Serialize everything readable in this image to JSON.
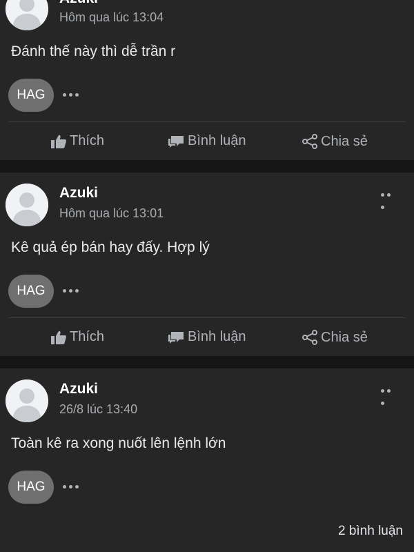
{
  "colors": {
    "page_background": "#151515",
    "card_background": "#262626",
    "tag_background": "#6f6f6f",
    "secondary_text": "#a8abaf"
  },
  "posts": [
    {
      "author": "Azuki",
      "time": "Hôm qua lúc 13:04",
      "text": "Đánh thế này thì dễ trần r",
      "tag": "HAG",
      "actions": {
        "like": "Thích",
        "comment": "Bình luận",
        "share": "Chia sẻ"
      }
    },
    {
      "author": "Azuki",
      "time": "Hôm qua lúc 13:01",
      "text": "Kê quả ép bán hay đấy. Hợp lý",
      "tag": "HAG",
      "actions": {
        "like": "Thích",
        "comment": "Bình luận",
        "share": "Chia sẻ"
      }
    },
    {
      "author": "Azuki",
      "time": "26/8 lúc 13:40",
      "text": "Toàn kê ra xong nuốt lên lệnh lớn",
      "tag": "HAG",
      "comment_count": "2 bình luận"
    }
  ],
  "icons": {
    "avatar": "default-avatar-icon",
    "more": "more-horizontal-icon",
    "like": "thumbs-up-icon",
    "comment": "speech-bubbles-icon",
    "share": "share-icon"
  }
}
